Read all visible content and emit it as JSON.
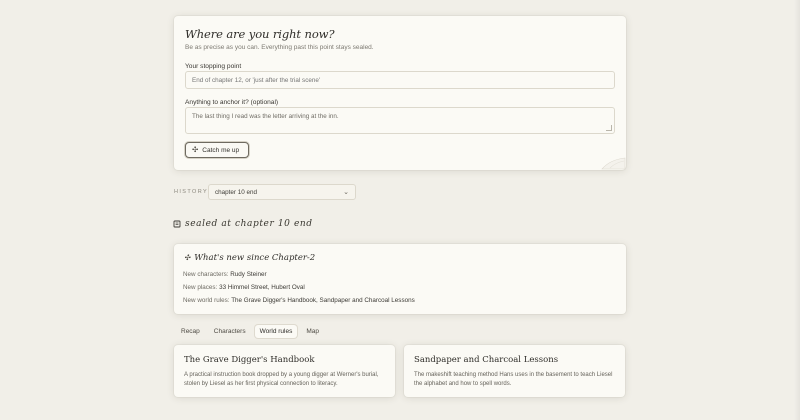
{
  "form": {
    "title": "Where are you right now?",
    "subtitle": "Be as precise as you can. Everything past this point stays sealed.",
    "stopping_label": "Your stopping point",
    "stopping_placeholder": "End of chapter 12, or 'just after the trial scene'",
    "anchor_label": "Anything to anchor it? (optional)",
    "anchor_placeholder": "The last thing I read was the letter arriving at the inn.",
    "button_label": "Catch me up",
    "button_icon": "sparkle-icon"
  },
  "history": {
    "label": "HISTORY",
    "selected": "chapter 10 end"
  },
  "sealed": {
    "text": "sealed at chapter 10 end",
    "icon": "seal-icon"
  },
  "whats_new": {
    "title": "What's new since Chapter-2",
    "characters_label": "New characters:",
    "characters_value": "Rudy Steiner",
    "places_label": "New places:",
    "places_value": "33 Himmel Street, Hubert Oval",
    "rules_label": "New world rules:",
    "rules_value": "The Grave Digger's Handbook, Sandpaper and Charcoal Lessons"
  },
  "tabs": [
    {
      "label": "Recap",
      "active": false
    },
    {
      "label": "Characters",
      "active": false
    },
    {
      "label": "World rules",
      "active": true
    },
    {
      "label": "Map",
      "active": false
    }
  ],
  "items": [
    {
      "title": "The Grave Digger's Handbook",
      "desc": "A practical instruction book dropped by a young digger at Werner's burial, stolen by Liesel as her first physical connection to literacy."
    },
    {
      "title": "Sandpaper and Charcoal Lessons",
      "desc": "The makeshift teaching method Hans uses in the basement to teach Liesel the alphabet and how to spell words."
    }
  ]
}
